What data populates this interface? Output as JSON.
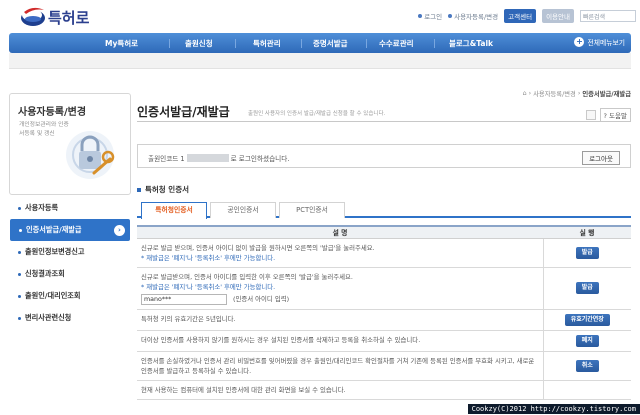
{
  "header": {
    "logo_text": "특허로",
    "utils": [
      "로그인",
      "사용자등록/변경"
    ],
    "pill_primary": "고객센터",
    "pill_secondary": "이용안내",
    "search_placeholder": "빠른검색"
  },
  "gnb": {
    "items": [
      "My특허로",
      "출원신청",
      "특허관리",
      "증명서발급",
      "수수료관리",
      "블로그&Talk"
    ],
    "all_menu": "전체메뉴보기"
  },
  "sidebar": {
    "title": "사용자등록/변경",
    "desc": "개인정보관리와 인증서등록 및 갱신",
    "items": [
      "사용자등록",
      "인증서발급/재발급",
      "출원인정보변경신고",
      "신청결과조회",
      "출원인/대리인조회",
      "변리사관련신청"
    ]
  },
  "breadcrumb": [
    "사용자등록/변경",
    "인증서발급/재발급"
  ],
  "page": {
    "title": "인증서발급/재발급",
    "desc": "출원인 사용자의 인증서 발급/재발급 신청을 할 수 있습니다.",
    "help": "도움말"
  },
  "login": {
    "prefix": "출원인코드 1",
    "suffix": "로 로그인하셨습니다.",
    "logout": "로그아웃"
  },
  "section_title": "특허청 인증서",
  "tabs": [
    "특허청인증서",
    "공인인증서",
    "PCT인증서"
  ],
  "table": {
    "headers": [
      "설 명",
      "실 행"
    ],
    "rows": [
      {
        "text": "신규로 발급 받으며, 인증서 아이디 없이 발급을 원하시면 오른쪽의 '발급'을 눌러주세요.",
        "note": "* 재발급은 '폐지'나 '등록취소' 후에만 가능합니다.",
        "button": "발급"
      },
      {
        "text": "신규로 발급받으며, 인증서 아이디를 입력한 이후 오른쪽의 '발급'을 눌러주세요.",
        "note": "* 재발급은 '폐지'나 '등록취소' 후에만 가능합니다.",
        "input_value": "mano***",
        "input_hint": "(인증서 아이디 입력)",
        "button": "발급"
      },
      {
        "text": "특허청 키의 유효기간은 5년입니다.",
        "button": "유효기간연장"
      },
      {
        "text": "더이상 인증서를 사용하지 않기를 원하시는 경우 설치된 인증서를 삭제하고 등록을 취소하실 수 있습니다.",
        "button": "폐지"
      },
      {
        "text": "인증서를 손실하였거나 인증서 관리 비밀번호를 잊어버렸을 경우 출원인/대리인코드 확인절차를 거쳐 기존에 등록된 인증서를 무효화 시키고, 새로운 인증서를 발급하고 등록하실 수 있습니다.",
        "button": "취소"
      },
      {
        "text": "현재 사용하는 컴퓨터에 설치된 인증서에 대한 관리 화면을 보실 수 있습니다."
      }
    ]
  },
  "watermark": "Cookzy(C)2012 http://cookzy.tistory.com"
}
